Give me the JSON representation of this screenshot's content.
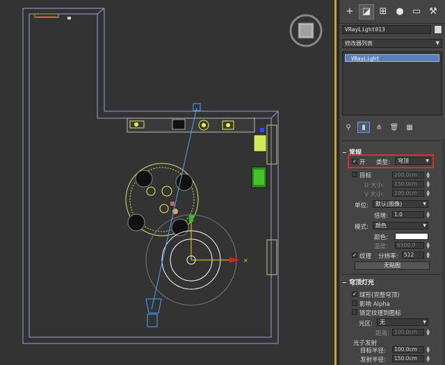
{
  "colors": {
    "viewport_bg": "#333333",
    "active_border": "#c9a227",
    "panel_bg": "#444444",
    "highlight_red": "#e0282e",
    "selection_blue": "#5b7fb5"
  },
  "command_panel": {
    "tabs": [
      {
        "name": "create-tab",
        "icon": "plus-icon",
        "glyph": "+"
      },
      {
        "name": "modify-tab",
        "icon": "modify-icon",
        "glyph": "◪"
      },
      {
        "name": "hierarchy-tab",
        "icon": "hierarchy-icon",
        "glyph": "⊞"
      },
      {
        "name": "motion-tab",
        "icon": "motion-icon",
        "glyph": "●"
      },
      {
        "name": "display-tab",
        "icon": "display-icon",
        "glyph": "▭"
      },
      {
        "name": "utilities-tab",
        "icon": "wrench-icon",
        "glyph": "🔧"
      }
    ],
    "object_name": "VRayLight013",
    "modifier_list": "修改器列表",
    "stack_item": "VRayLight"
  },
  "general": {
    "title": "常规",
    "on_label": "开",
    "type_label": "类型:",
    "type_value": "穹顶",
    "target_label": "目标",
    "target_value": "200.0cm",
    "u_size_label": "U 大小:",
    "u_size_value": "150.0cm",
    "v_size_label": "V 大小:",
    "v_size_value": "100.0cm",
    "units_label": "单位:",
    "units_value": "默认(图像)",
    "multiplier_label": "倍增:",
    "multiplier_value": "1.0",
    "mode_label": "模式:",
    "mode_value": "颜色",
    "color_label": "颜色:",
    "temperature_label": "温度:",
    "temperature_value": "6500.0",
    "texture_label": "纹理",
    "resolution_label": "分辨率:",
    "resolution_value": "512",
    "no_map_label": "无贴图"
  },
  "dome": {
    "title": "穹顶灯光",
    "spherical_label": "球形(完整穹顶)",
    "affect_alpha_label": "影响 Alpha",
    "lock_texture_label": "锁定纹理到图标",
    "zone_label": "光区:",
    "zone_value": "无",
    "distance_label": "距离:",
    "distance_value": "100.0cm",
    "photon_label": "光子发射",
    "target_radius_label": "目标半径:",
    "target_radius_value": "100.0cm",
    "emit_radius_label": "发射半径:",
    "emit_radius_value": "150.0cm"
  }
}
